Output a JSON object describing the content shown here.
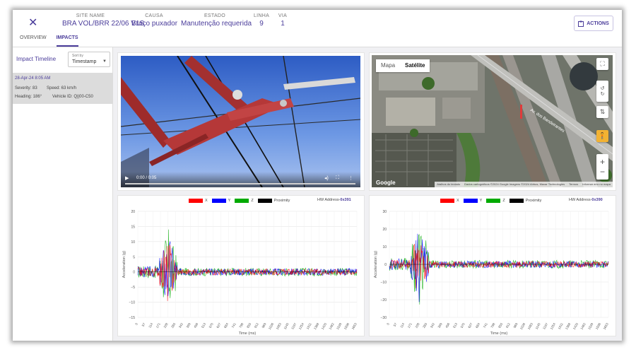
{
  "header": {
    "close_label": "✕",
    "fields": [
      {
        "label": "SITE NAME",
        "value": "BRA VOL/BRR 22/06 V1S"
      },
      {
        "label": "CAUSA",
        "value": "Braço puxador"
      },
      {
        "label": "ESTADO",
        "value": "Manutenção requerida"
      },
      {
        "label": "LINHA",
        "value": "9"
      },
      {
        "label": "VIA",
        "value": "1"
      }
    ],
    "actions_label": "ACTIONS"
  },
  "tabs": [
    {
      "label": "OVERVIEW",
      "active": false
    },
    {
      "label": "IMPACTS",
      "active": true
    }
  ],
  "sidebar": {
    "title": "Impact Timeline",
    "sort": {
      "label": "Sort by",
      "value": "Timestamp"
    },
    "entries": [
      {
        "timestamp": "28-Apr-24 8:05 AM",
        "severity": "Severity: 83",
        "speed": "Speed: 63 km/h",
        "heading": "Heading: 186°",
        "vehicle": "Vehicle ID: Q||00-C50"
      }
    ]
  },
  "video": {
    "time": "0:00 / 0:05"
  },
  "map": {
    "toggle": [
      "Mapa",
      "Satélite"
    ],
    "active_toggle": "Satélite",
    "road_label": "Av. dos Bandeirantes",
    "attribution": [
      "Atalhos do teclado",
      "Dados cartográficos ©2024 Google Imagens ©2024 Airbus, Maxar Technologies",
      "Termos",
      "Informar erro no mapa"
    ],
    "logo": "Google",
    "zoom_in": "+",
    "zoom_out": "−"
  },
  "charts": [
    {
      "hw_label": "HW Address-",
      "hw_value": "0x391",
      "legend": [
        "X",
        "Y",
        "Z",
        "Proximity"
      ],
      "colors": [
        "#ff0000",
        "#0000ff",
        "#00aa00",
        "#000000"
      ],
      "ylabel": "Acceleration (g)",
      "xlabel": "Time (ms)",
      "y_ticks": [
        "20",
        "15",
        "10",
        "5",
        "0",
        "−5",
        "−10",
        "−15"
      ],
      "x_ticks": [
        "0",
        "57",
        "114",
        "171",
        "228",
        "285",
        "342",
        "399",
        "456",
        "513",
        "570",
        "627",
        "684",
        "741",
        "798",
        "855",
        "912",
        "969",
        "1026",
        "1083",
        "1140",
        "1197",
        "1254",
        "1311",
        "1368",
        "1425",
        "1482",
        "1539",
        "1596",
        "1653"
      ],
      "chart_data": {
        "type": "line",
        "ylim": [
          -15,
          20
        ],
        "xlim": [
          0,
          1653
        ],
        "grid": true,
        "spike_at_ms": 228
      }
    },
    {
      "hw_label": "HW Address-",
      "hw_value": "0x390",
      "legend": [
        "X",
        "Y",
        "Z",
        "Proximity"
      ],
      "colors": [
        "#ff0000",
        "#0000ff",
        "#00aa00",
        "#000000"
      ],
      "ylabel": "Acceleration (g)",
      "xlabel": "Time (ms)",
      "y_ticks": [
        "30",
        "20",
        "10",
        "0",
        "−10",
        "−20",
        "−30"
      ],
      "x_ticks": [
        "0",
        "57",
        "114",
        "171",
        "228",
        "285",
        "342",
        "399",
        "456",
        "513",
        "570",
        "627",
        "684",
        "741",
        "798",
        "855",
        "912",
        "969",
        "1026",
        "1083",
        "1140",
        "1197",
        "1254",
        "1311",
        "1368",
        "1425",
        "1482",
        "1539",
        "1596",
        "1653"
      ],
      "chart_data": {
        "type": "line",
        "ylim": [
          -30,
          30
        ],
        "xlim": [
          0,
          1653
        ],
        "grid": true,
        "spike_at_ms": 228
      }
    }
  ]
}
